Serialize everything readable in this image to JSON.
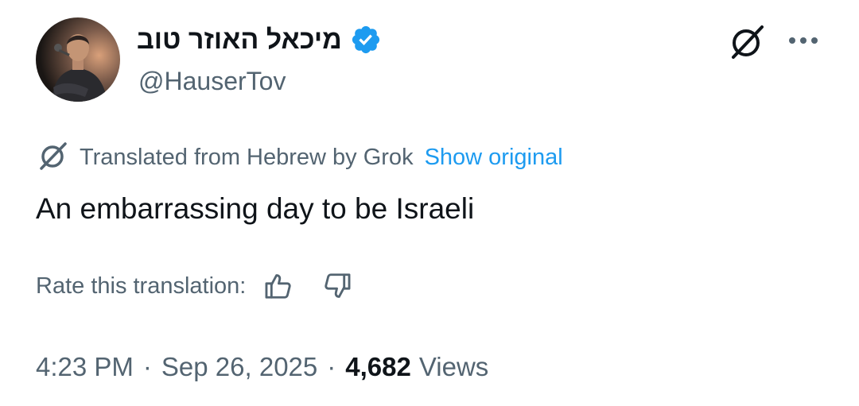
{
  "author": {
    "display_name": "מיכאל האוזר טוב",
    "handle": "@HauserTov",
    "verified_icon": "verified-badge-icon",
    "avatar": "profile-photo"
  },
  "header_actions": {
    "grok_icon": "grok-icon",
    "more_icon": "more-horizontal-icon"
  },
  "translation": {
    "icon": "grok-icon",
    "label": "Translated from Hebrew by Grok",
    "show_original": "Show original"
  },
  "tweet": {
    "text": "An embarrassing day to be Israeli"
  },
  "rating": {
    "label": "Rate this translation:",
    "thumbs_up_icon": "thumbs-up-icon",
    "thumbs_down_icon": "thumbs-down-icon"
  },
  "meta": {
    "time": "4:23 PM",
    "separator": "·",
    "date": "Sep 26, 2025",
    "views_count": "4,682",
    "views_label": "Views"
  },
  "colors": {
    "primary_text": "#0f1419",
    "secondary_text": "#536471",
    "link": "#1d9bf0",
    "verified": "#1d9bf0"
  }
}
